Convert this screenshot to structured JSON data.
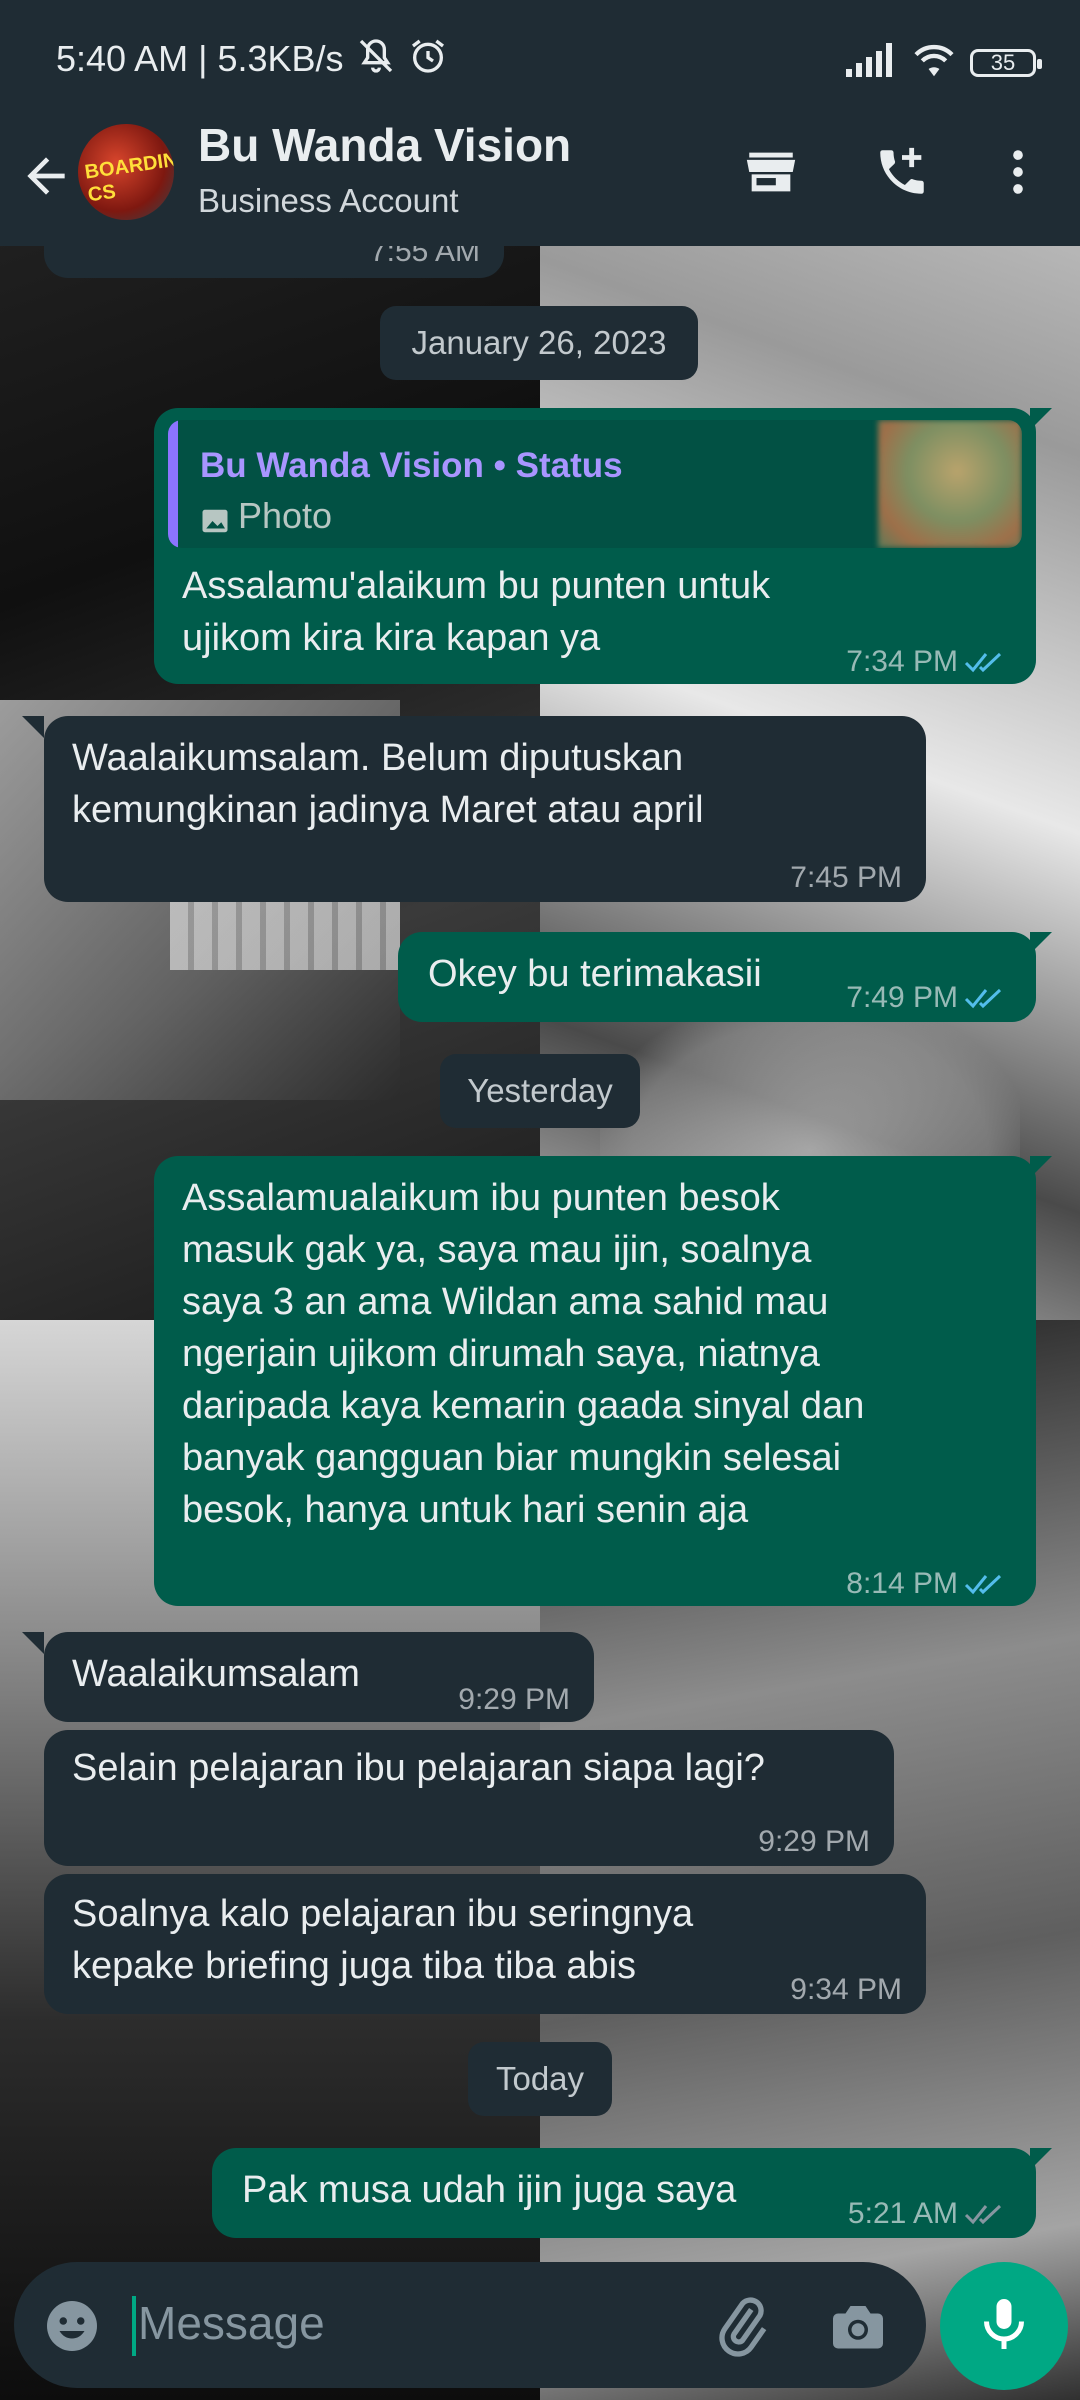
{
  "status_bar": {
    "time": "5:40 AM | 5.3KB/s",
    "battery": "35"
  },
  "header": {
    "title": "Bu Wanda Vision",
    "subtitle": "Business Account",
    "avatar_text": "BOARDING CS"
  },
  "partial_top_time": "7:55 AM",
  "dates": {
    "jan26": "January 26, 2023",
    "yesterday": "Yesterday",
    "today": "Today"
  },
  "messages": [
    {
      "dir": "out",
      "quote": {
        "name": "Bu Wanda Vision • Status",
        "type": "Photo"
      },
      "lines": [
        "Assalamu'alaikum bu punten untuk",
        "ujikom kira kira kapan ya"
      ],
      "time": "7:34 PM"
    },
    {
      "dir": "in",
      "lines": [
        "Waalaikumsalam. Belum diputuskan",
        "kemungkinan jadinya Maret atau april"
      ],
      "time": "7:45 PM"
    },
    {
      "dir": "out",
      "lines": [
        "Okey bu terimakasii"
      ],
      "time": "7:49 PM"
    },
    {
      "dir": "out",
      "lines": [
        "Assalamualaikum ibu punten besok",
        "masuk gak ya, saya mau ijin, soalnya",
        "saya 3 an ama Wildan ama sahid mau",
        "ngerjain ujikom dirumah saya, niatnya",
        "daripada kaya kemarin gaada sinyal dan",
        "banyak gangguan biar mungkin selesai",
        "besok, hanya untuk hari senin aja"
      ],
      "time": "8:14 PM"
    },
    {
      "dir": "in",
      "lines": [
        "Waalaikumsalam"
      ],
      "time": "9:29 PM"
    },
    {
      "dir": "in",
      "lines": [
        "Selain pelajaran ibu pelajaran siapa lagi?"
      ],
      "time": "9:29 PM"
    },
    {
      "dir": "in",
      "lines": [
        "Soalnya kalo pelajaran ibu seringnya",
        "kepake briefing juga tiba tiba abis"
      ],
      "time": "9:34 PM"
    },
    {
      "dir": "out",
      "lines": [
        "Pak musa udah ijin juga saya"
      ],
      "time": "5:21 AM"
    }
  ],
  "composer": {
    "placeholder": "Message"
  },
  "colors": {
    "header_bg": "#1f2c34",
    "incoming_bubble": "#1f2c34",
    "outgoing_bubble": "#005c4b",
    "read_ticks": "#53bdeb",
    "delivered_ticks": "#8696a0",
    "accent": "#00a884"
  },
  "icons": {
    "back": "arrow-left-icon",
    "store": "store-icon",
    "call": "add-call-icon",
    "menu": "more-vert-icon",
    "emoji": "emoji-icon",
    "attach": "paperclip-icon",
    "camera": "camera-icon",
    "mic": "mic-icon"
  }
}
